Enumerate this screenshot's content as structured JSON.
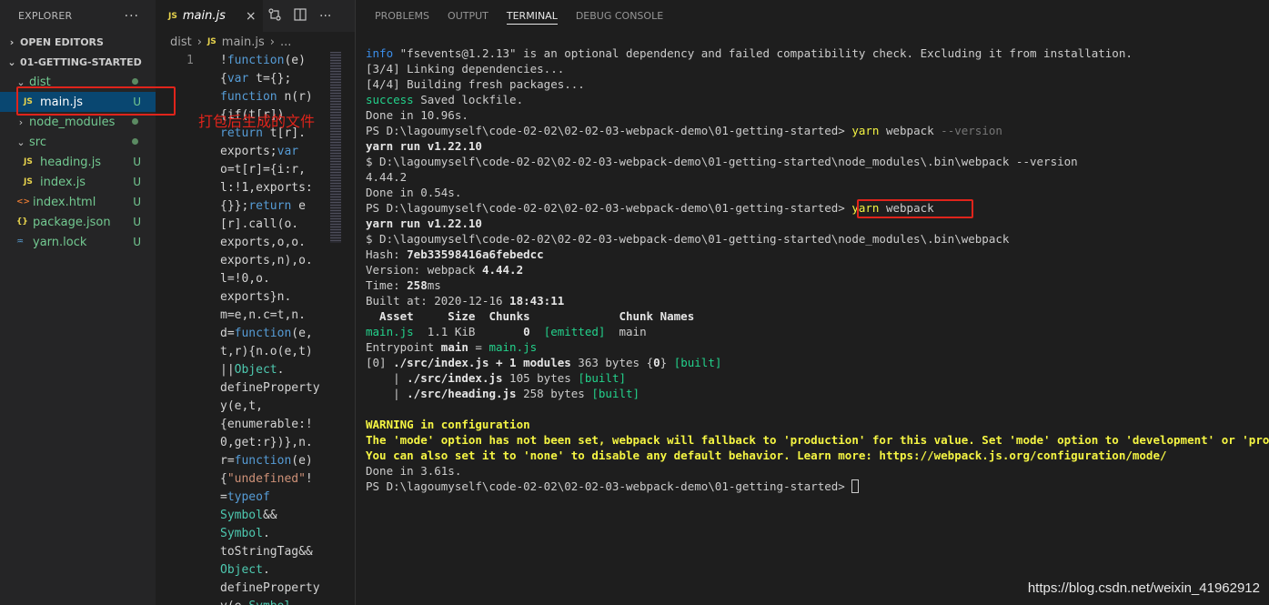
{
  "explorer": {
    "title": "EXPLORER",
    "more": "···",
    "open_editors": "OPEN EDITORS",
    "project": "01-GETTING-STARTED",
    "tree": [
      {
        "label": "dist",
        "kind": "folder",
        "status": "dot",
        "depth": 1
      },
      {
        "label": "main.js",
        "kind": "js",
        "status": "U",
        "depth": 2
      },
      {
        "label": "node_modules",
        "kind": "folder",
        "status": "dot",
        "depth": 1
      },
      {
        "label": "src",
        "kind": "folder",
        "status": "dot",
        "depth": 1
      },
      {
        "label": "heading.js",
        "kind": "js",
        "status": "U",
        "depth": 2
      },
      {
        "label": "index.js",
        "kind": "js",
        "status": "U",
        "depth": 2
      },
      {
        "label": "index.html",
        "kind": "html",
        "status": "U",
        "depth": 1
      },
      {
        "label": "package.json",
        "kind": "json",
        "status": "U",
        "depth": 1
      },
      {
        "label": "yarn.lock",
        "kind": "yarn",
        "status": "U",
        "depth": 1
      }
    ]
  },
  "editor": {
    "tab_label": "main.js",
    "tab_icon": "JS",
    "tab_close": "×",
    "breadcrumb": [
      "dist",
      "main.js",
      "..."
    ],
    "line_number": "1",
    "code_lines": [
      "!function(e)",
      "{var t={};",
      "function n(r)",
      "{if(t[r])",
      "return t[r].",
      "exports;var",
      "o=t[r]={i:r,",
      "l:!1,exports:",
      "{}};return e",
      "[r].call(o.",
      "exports,o,o.",
      "exports,n),o.",
      "l=!0,o.",
      "exports}n.",
      "m=e,n.c=t,n.",
      "d=function(e,",
      "t,r){n.o(e,t)",
      "||Object.",
      "defineProperty",
      "y(e,t,",
      "{enumerable:!",
      "0,get:r})},n.",
      "r=function(e)",
      "{\"undefined\"!",
      "=typeof",
      "Symbol&&",
      "Symbol.",
      "toStringTag&&",
      "Object.",
      "defineProperty",
      "y(e,Symbol."
    ]
  },
  "panel": {
    "tabs": [
      "PROBLEMS",
      "OUTPUT",
      "TERMINAL",
      "DEBUG CONSOLE"
    ],
    "active_tab": "TERMINAL",
    "terminal": {
      "l1_tag": "info",
      "l1_text": " \"fsevents@1.2.13\" is an optional dependency and failed compatibility check. Excluding it from installation.",
      "l2": "[3/4] Linking dependencies...",
      "l3": "[4/4] Building fresh packages...",
      "l4_tag": "success",
      "l4_text": " Saved lockfile.",
      "l5": "Done in 10.96s.",
      "prompt": "PS D:\\lagoumyself\\code-02-02\\02-02-03-webpack-demo\\01-getting-started> ",
      "cmd1_yarn": "yarn",
      "cmd1_rest": " webpack ",
      "cmd1_flag": "--version",
      "l7": "yarn run v1.22.10",
      "l8": "$ D:\\lagoumyself\\code-02-02\\02-02-03-webpack-demo\\01-getting-started\\node_modules\\.bin\\webpack --version",
      "l9": "4.44.2",
      "l10": "Done in 0.54s.",
      "cmd2_yarn": "yarn",
      "cmd2_rest": " webpack",
      "l12": "yarn run v1.22.10",
      "l13": "$ D:\\lagoumyself\\code-02-02\\02-02-03-webpack-demo\\01-getting-started\\node_modules\\.bin\\webpack",
      "hash_label": "Hash: ",
      "hash_value": "7eb33598416a6febedcc",
      "version_label": "Version: webpack ",
      "version_value": "4.44.2",
      "time_label": "Time: ",
      "time_value": "258",
      "time_unit": "ms",
      "built_label": "Built at: 2020-12-16 ",
      "built_time": "18:43:11",
      "table_header": "  Asset     Size  Chunks             Chunk Names",
      "asset_name": "main.js",
      "asset_size": "  1.1 KiB       ",
      "asset_chunk": "0",
      "asset_emitted": "  [emitted]",
      "asset_chunk_name": "  main",
      "entry_label": "Entrypoint ",
      "entry_main": "main",
      "entry_eq": " = ",
      "entry_file": "main.js",
      "mod0_idx": "[0] ",
      "mod0_path": "./src/index.js + 1 modules",
      "mod0_size": " 363 bytes {",
      "mod0_chunk": "0",
      "mod0_close": "} ",
      "mod0_built": "[built]",
      "mod1_pre": "    | ",
      "mod1_path": "./src/index.js",
      "mod1_size": " 105 bytes ",
      "mod1_built": "[built]",
      "mod2_pre": "    | ",
      "mod2_path": "./src/heading.js",
      "mod2_size": " 258 bytes ",
      "mod2_built": "[built]",
      "warn1": "WARNING in configuration",
      "warn2": "The 'mode' option has not been set, webpack will fallback to 'production' for this value. Set 'mode' option to 'development' or 'production' to enable defaults for each environment.",
      "warn3": "You can also set it to 'none' to disable any default behavior. Learn more: https://webpack.js.org/configuration/mode/",
      "done_final": "Done in 3.61s."
    }
  },
  "annotation": {
    "text": "打包后生成的文件",
    "color": "#e0241b"
  },
  "watermark": "https://blog.csdn.net/weixin_41962912"
}
